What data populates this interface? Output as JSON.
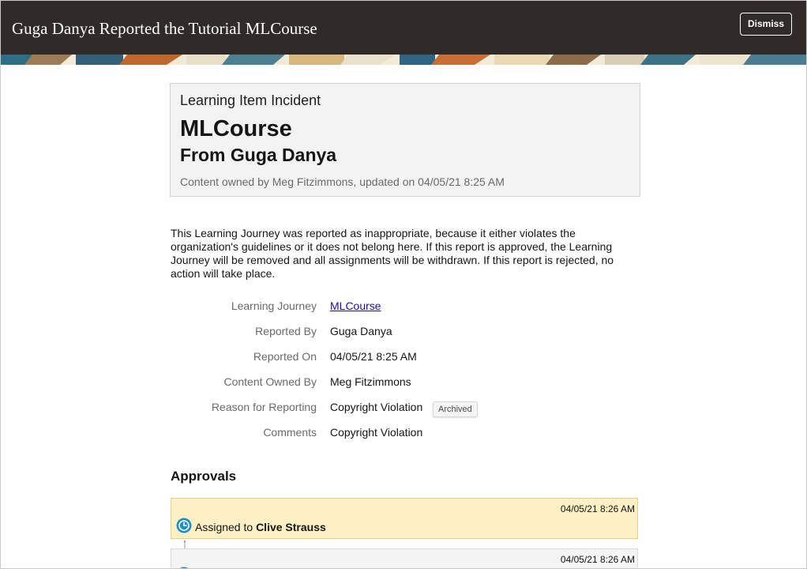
{
  "header": {
    "title": "Guga Danya Reported the Tutorial MLCourse",
    "dismiss_label": "Dismiss"
  },
  "card": {
    "kicker": "Learning Item Incident",
    "title": "MLCourse",
    "subtitle": "From Guga Danya",
    "meta": "Content owned by Meg Fitzimmons, updated on 04/05/21 8:25 AM"
  },
  "description": "This Learning Journey was reported as inappropriate, because it either violates the organization's guidelines or it does not belong here. If this report is approved, the Learning Journey will be removed and all assignments will be withdrawn. If this report is rejected, no action will take place.",
  "details": {
    "learning_journey": {
      "label": "Learning Journey",
      "value": "MLCourse"
    },
    "reported_by": {
      "label": "Reported By",
      "value": "Guga Danya"
    },
    "reported_on": {
      "label": "Reported On",
      "value": "04/05/21 8:25 AM"
    },
    "content_owned_by": {
      "label": "Content Owned By",
      "value": "Meg Fitzimmons"
    },
    "reason": {
      "label": "Reason for Reporting",
      "value": "Copyright Violation",
      "badge": "Archived"
    },
    "comments": {
      "label": "Comments",
      "value": "Copyright Violation"
    }
  },
  "approvals": {
    "heading": "Approvals",
    "items": [
      {
        "time": "04/05/21 8:26 AM",
        "prefix": "Assigned to",
        "name": "Clive Strauss",
        "icon": "clock-icon"
      },
      {
        "time": "04/05/21 8:26 AM",
        "icon": "clock-icon"
      }
    ]
  },
  "colors": {
    "header_bg": "#302b28",
    "active_approval_bg": "#fcf0c4",
    "link": "#1a0dab",
    "icon_blue": "#1f8fc7"
  }
}
